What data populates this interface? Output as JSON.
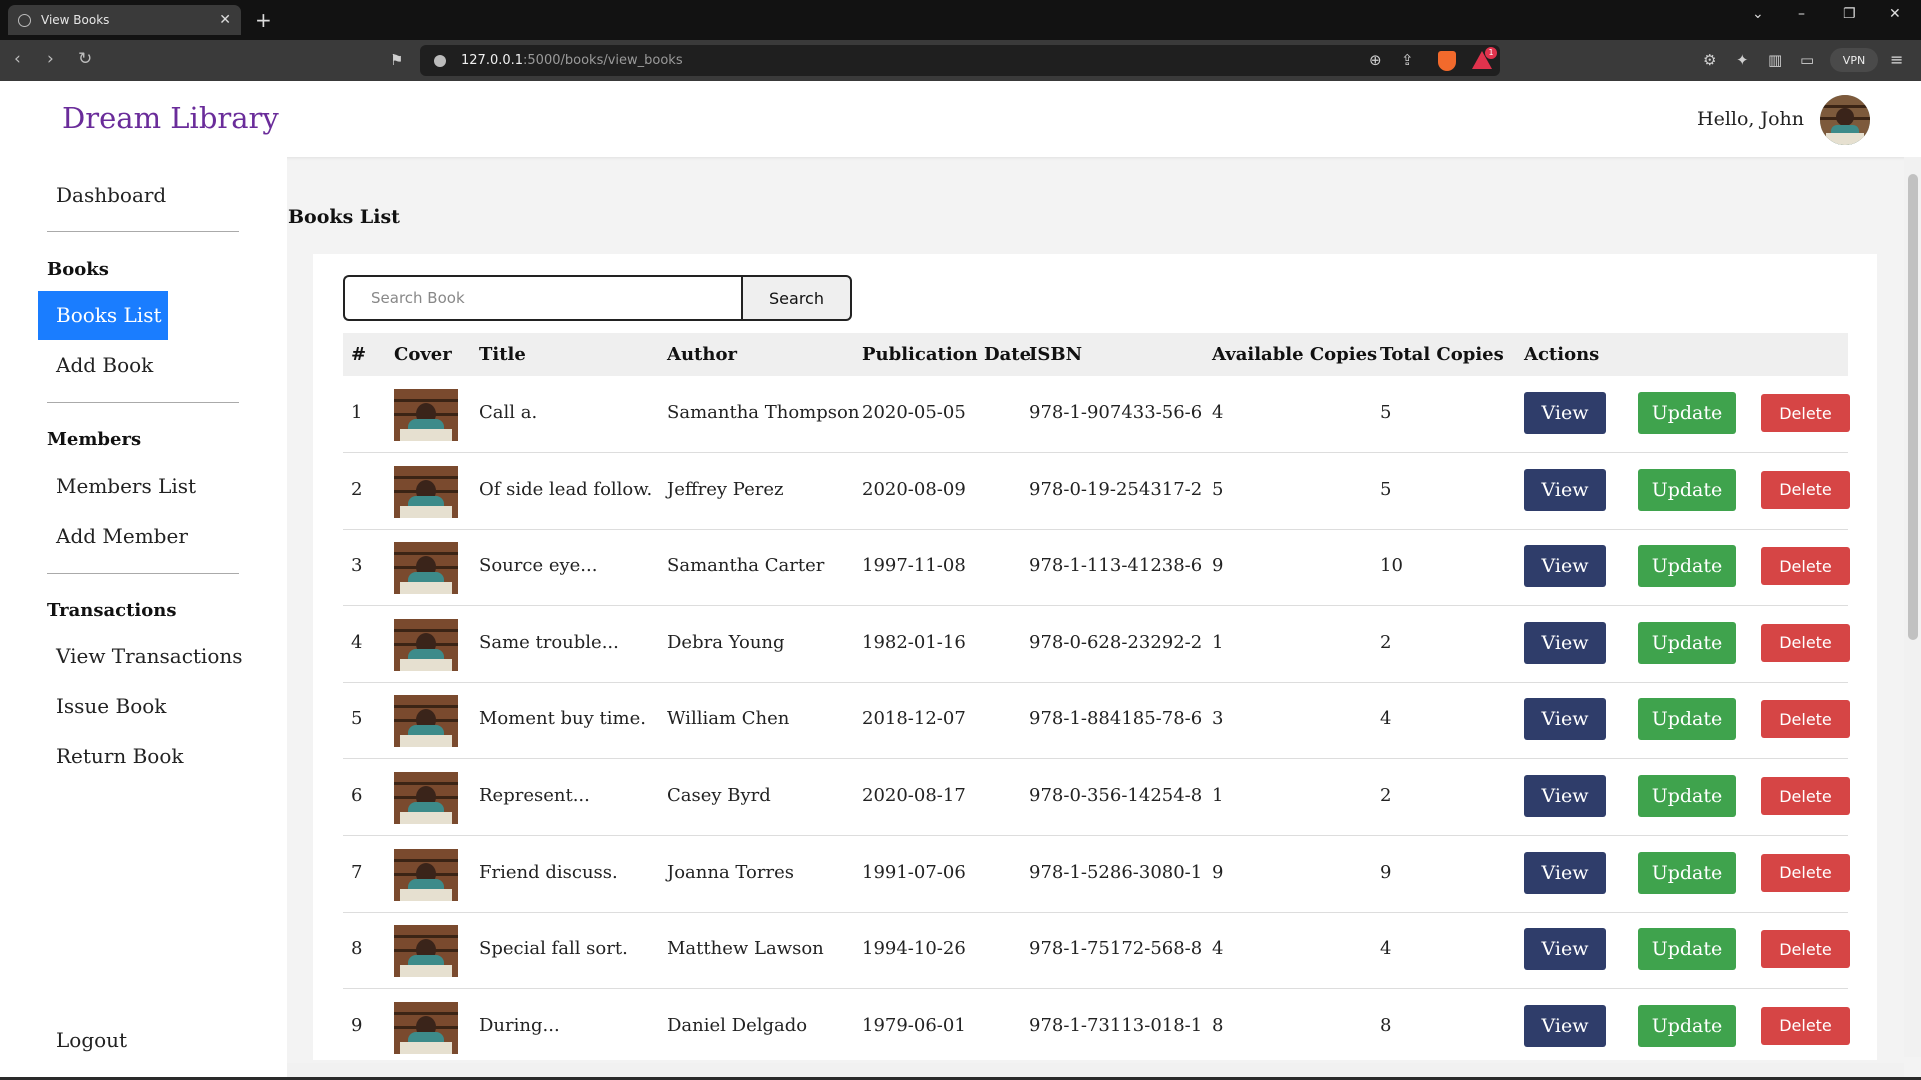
{
  "browser": {
    "tab_title": "View Books",
    "url_host": "127.0.0.1",
    "url_path": ":5000/books/view_books",
    "vpn_label": "VPN",
    "notification_count": "1"
  },
  "header": {
    "brand": "Dream Library",
    "greeting": "Hello, John"
  },
  "sidebar": {
    "dashboard": "Dashboard",
    "books_heading": "Books",
    "books_list": "Books List",
    "add_book": "Add Book",
    "members_heading": "Members",
    "members_list": "Members List",
    "add_member": "Add Member",
    "transactions_heading": "Transactions",
    "view_transactions": "View Transactions",
    "issue_book": "Issue Book",
    "return_book": "Return Book",
    "logout": "Logout"
  },
  "main": {
    "page_title": "Books List",
    "search_placeholder": "Search Book",
    "search_button": "Search",
    "columns": [
      "#",
      "Cover",
      "Title",
      "Author",
      "Publication Date",
      "ISBN",
      "Available Copies",
      "Total Copies",
      "Actions"
    ],
    "actions": {
      "view": "View",
      "update": "Update",
      "delete": "Delete"
    },
    "rows": [
      {
        "num": "1",
        "title": "Call a.",
        "author": "Samantha Thompson",
        "date": "2020-05-05",
        "isbn": "978-1-907433-56-6",
        "available": "4",
        "total": "5"
      },
      {
        "num": "2",
        "title": "Of side lead follow.",
        "author": "Jeffrey Perez",
        "date": "2020-08-09",
        "isbn": "978-0-19-254317-2",
        "available": "5",
        "total": "5"
      },
      {
        "num": "3",
        "title": "Source eye...",
        "author": "Samantha Carter",
        "date": "1997-11-08",
        "isbn": "978-1-113-41238-6",
        "available": "9",
        "total": "10"
      },
      {
        "num": "4",
        "title": "Same trouble...",
        "author": "Debra Young",
        "date": "1982-01-16",
        "isbn": "978-0-628-23292-2",
        "available": "1",
        "total": "2"
      },
      {
        "num": "5",
        "title": "Moment buy time.",
        "author": "William Chen",
        "date": "2018-12-07",
        "isbn": "978-1-884185-78-6",
        "available": "3",
        "total": "4"
      },
      {
        "num": "6",
        "title": "Represent...",
        "author": "Casey Byrd",
        "date": "2020-08-17",
        "isbn": "978-0-356-14254-8",
        "available": "1",
        "total": "2"
      },
      {
        "num": "7",
        "title": "Friend discuss.",
        "author": "Joanna Torres",
        "date": "1991-07-06",
        "isbn": "978-1-5286-3080-1",
        "available": "9",
        "total": "9"
      },
      {
        "num": "8",
        "title": "Special fall sort.",
        "author": "Matthew Lawson",
        "date": "1994-10-26",
        "isbn": "978-1-75172-568-8",
        "available": "4",
        "total": "4"
      },
      {
        "num": "9",
        "title": "During...",
        "author": "Daniel Delgado",
        "date": "1979-06-01",
        "isbn": "978-1-73113-018-1",
        "available": "8",
        "total": "8"
      }
    ]
  },
  "colors": {
    "brand": "#6a2c9a",
    "active": "#1a7dff",
    "view": "#2f3d6a",
    "update": "#3fa34d",
    "delete": "#d64545"
  }
}
